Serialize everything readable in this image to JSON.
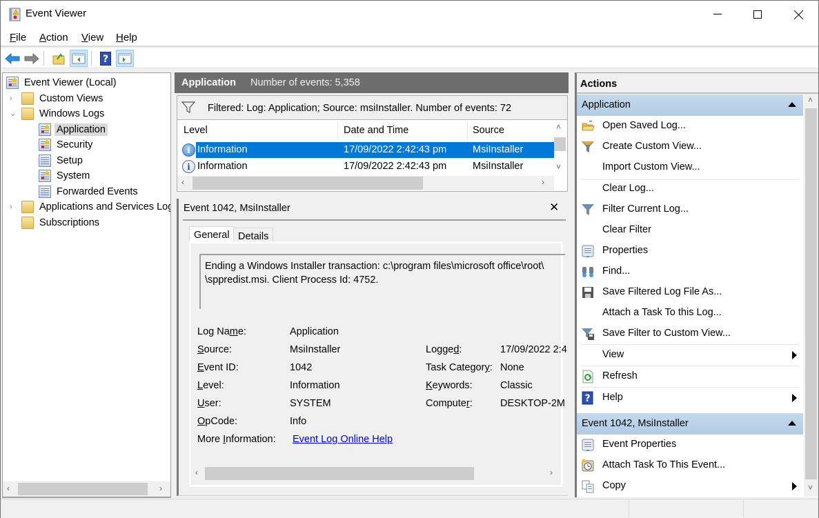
{
  "window": {
    "title": "Event Viewer",
    "controls": {
      "minimize": "—",
      "maximize": "☐",
      "close": "✕"
    }
  },
  "menu": {
    "items": [
      {
        "label": "File",
        "accel": "F",
        "rest": "ile"
      },
      {
        "label": "Action",
        "accel": "A",
        "rest": "ction"
      },
      {
        "label": "View",
        "accel": "V",
        "rest": "iew"
      },
      {
        "label": "Help",
        "accel": "H",
        "rest": "elp"
      }
    ]
  },
  "toolbar": {
    "buttons": [
      "back",
      "forward",
      "up-one-level",
      "show-hide-console-tree",
      "help",
      "show-hide-action-pane"
    ]
  },
  "tree": {
    "root": "Event Viewer (Local)",
    "items": [
      {
        "label": "Custom Views",
        "icon": "folder-filter-icon",
        "expanded": false
      },
      {
        "label": "Windows Logs",
        "icon": "folder-windows-icon",
        "expanded": true
      },
      {
        "label": "Application",
        "icon": "log-warning-icon",
        "selected": true
      },
      {
        "label": "Security",
        "icon": "log-warning-icon"
      },
      {
        "label": "Setup",
        "icon": "log-icon"
      },
      {
        "label": "System",
        "icon": "log-warning-icon"
      },
      {
        "label": "Forwarded Events",
        "icon": "log-icon"
      },
      {
        "label": "Applications and Services Log",
        "icon": "folder-icon",
        "expanded": false
      },
      {
        "label": "Subscriptions",
        "icon": "subscriptions-icon"
      }
    ]
  },
  "main": {
    "header_title": "Application",
    "header_count": "Number of events: 5,358",
    "filter_text": "Filtered: Log: Application; Source: msiInstaller. Number of events: 72",
    "columns": [
      "Level",
      "Date and Time",
      "Source"
    ],
    "rows": [
      {
        "level": "Information",
        "datetime": "17/09/2022 2:42:43 pm",
        "source": "MsiInstaller",
        "selected": true
      },
      {
        "level": "Information",
        "datetime": "17/09/2022 2:42:43 pm",
        "source": "MsiInstaller",
        "selected": false
      }
    ]
  },
  "detail": {
    "title": "Event 1042, MsiInstaller",
    "close": "✕",
    "tabs": [
      "General",
      "Details"
    ],
    "active_tab": "General",
    "description_line1": "Ending a Windows Installer transaction: c:\\program files\\microsoft office\\root\\",
    "description_line2": "\\sppredist.msi. Client Process Id: 4752.",
    "fields_left": [
      {
        "pre": "Log Na",
        "accel": "m",
        "post": "e:",
        "value": "Application"
      },
      {
        "pre": "",
        "accel": "S",
        "post": "ource:",
        "value": "MsiInstaller"
      },
      {
        "pre": "",
        "accel": "E",
        "post": "vent ID:",
        "value": "1042"
      },
      {
        "pre": "",
        "accel": "L",
        "post": "evel:",
        "value": "Information"
      },
      {
        "pre": "",
        "accel": "U",
        "post": "ser:",
        "value": "SYSTEM"
      },
      {
        "pre": "",
        "accel": "O",
        "post": "pCode:",
        "value": "Info"
      }
    ],
    "fields_right": [
      {
        "pre": "Logge",
        "accel": "d",
        "post": ":",
        "value": "17/09/2022 2:4"
      },
      {
        "pre": "Task Categor",
        "accel": "y",
        "post": ":",
        "value": "None"
      },
      {
        "pre": "",
        "accel": "K",
        "post": "eywords:",
        "value": "Classic"
      },
      {
        "pre": "Compute",
        "accel": "r",
        "post": ":",
        "value": "DESKTOP-2M"
      }
    ],
    "more_info": {
      "pre": "More ",
      "accel": "I",
      "post": "nformation:",
      "link": "Event Log Online Help"
    }
  },
  "actions": {
    "title": "Actions",
    "sections": [
      {
        "title": "Application",
        "items": [
          {
            "label": "Open Saved Log...",
            "icon": "open-folder-icon"
          },
          {
            "label": "Create Custom View...",
            "icon": "filter-create-icon"
          },
          {
            "label": "Import Custom View...",
            "icon": ""
          },
          {
            "label": "Clear Log...",
            "icon": ""
          },
          {
            "label": "Filter Current Log...",
            "icon": "filter-icon"
          },
          {
            "label": "Clear Filter",
            "icon": ""
          },
          {
            "label": "Properties",
            "icon": "properties-icon"
          },
          {
            "label": "Find...",
            "icon": "binoculars-icon"
          },
          {
            "label": "Save Filtered Log File As...",
            "icon": "floppy-icon"
          },
          {
            "label": "Attach a Task To this Log...",
            "icon": ""
          },
          {
            "label": "Save Filter to Custom View...",
            "icon": "filter-save-icon"
          },
          {
            "label": "View",
            "icon": "",
            "submenu": true
          },
          {
            "label": "Refresh",
            "icon": "refresh-icon"
          },
          {
            "label": "Help",
            "icon": "help-icon",
            "submenu": true
          }
        ]
      },
      {
        "title": "Event 1042, MsiInstaller",
        "items": [
          {
            "label": "Event Properties",
            "icon": "properties-icon"
          },
          {
            "label": "Attach Task To This Event...",
            "icon": "task-clock-icon"
          },
          {
            "label": "Copy",
            "icon": "copy-icon",
            "submenu": true
          }
        ]
      }
    ]
  }
}
